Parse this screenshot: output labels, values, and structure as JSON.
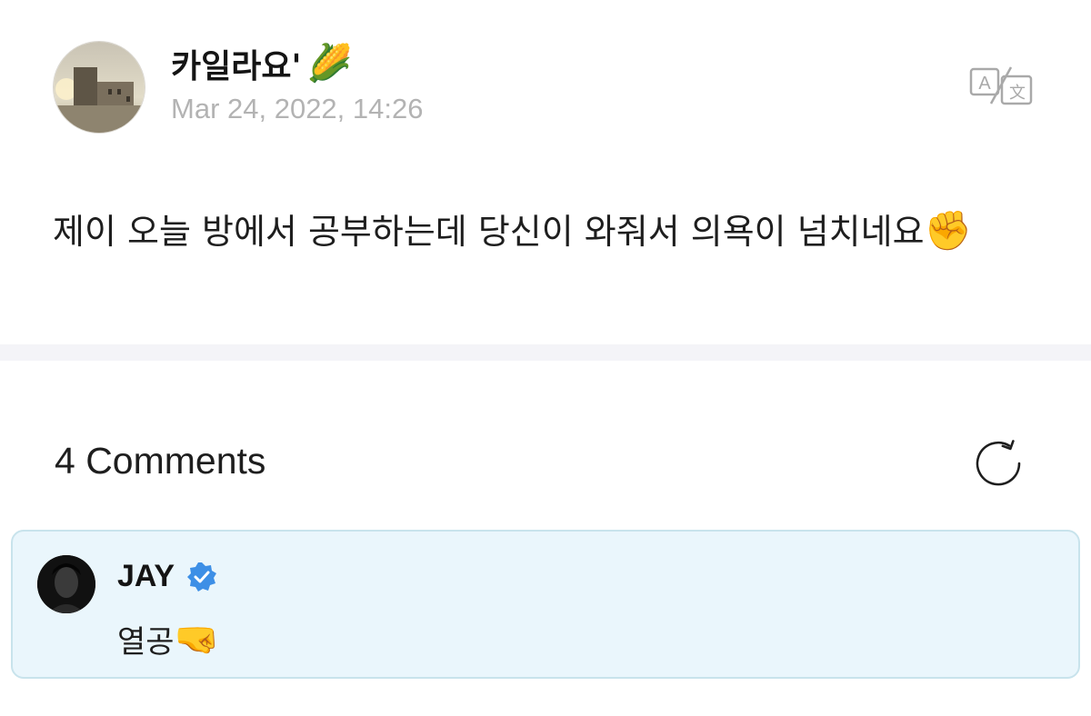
{
  "post": {
    "author": {
      "name": "카일라요'",
      "name_emoji": "🌽",
      "avatar_icon": "avatar-photo"
    },
    "date": "Mar 24, 2022, 14:26",
    "translate_icon": "translate-icon",
    "body_text": "제이 오늘 방에서 공부하는데 당신이 와줘서 의욕이 넘치네요",
    "body_emoji": "✊"
  },
  "comments": {
    "header": "4 Comments",
    "refresh_icon": "refresh-icon",
    "items": [
      {
        "author": "JAY",
        "verified": true,
        "text": "열공",
        "emoji": "🤜"
      }
    ]
  },
  "colors": {
    "date": "#b3b3b3",
    "divider": "#f4f4f8",
    "comment_bg": "#eaf6fc",
    "comment_border": "#c8e3ec",
    "verified": "#3d8fe6"
  }
}
